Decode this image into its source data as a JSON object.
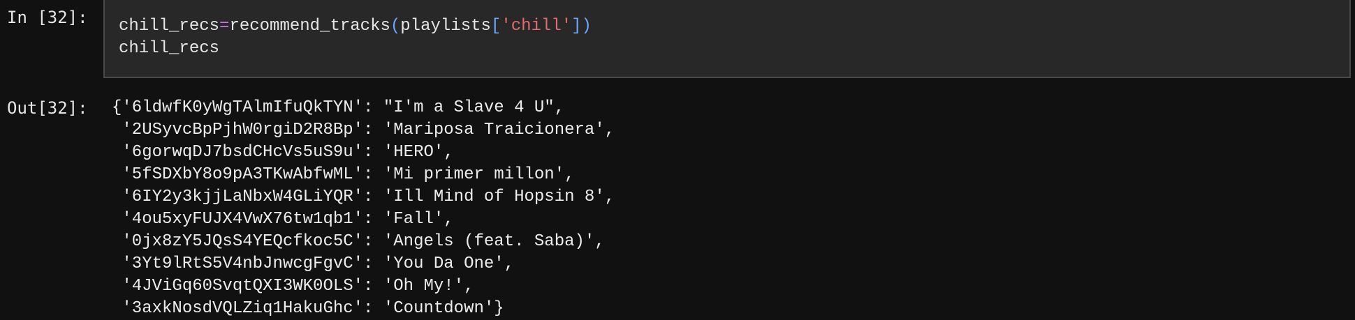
{
  "input_cell": {
    "prompt": "In [32]:",
    "code": {
      "line1": {
        "var": "chill_recs",
        "op": "=",
        "func": "recommend_tracks",
        "open_paren": "(",
        "arg_name": "playlists",
        "open_bracket": "[",
        "key": "'chill'",
        "close_bracket": "]",
        "close_paren": ")"
      },
      "line2": "chill_recs"
    }
  },
  "output_cell": {
    "prompt": "Out[32]:",
    "lines": [
      "{'6ldwfK0yWgTAlmIfuQkTYN': \"I'm a Slave 4 U\",",
      " '2USyvcBpPjhW0rgiD2R8Bp': 'Mariposa Traicionera',",
      " '6gorwqDJ7bsdCHcVs5uS9u': 'HERO',",
      " '5fSDXbY8o9pA3TKwAbfwML': 'Mi primer millon',",
      " '6IY2y3kjjLaNbxW4GLiYQR': 'Ill Mind of Hopsin 8',",
      " '4ou5xyFUJX4VwX76tw1qb1': 'Fall',",
      " '0jx8zY5JQsS4YEQcfkoc5C': 'Angels (feat. Saba)',",
      " '3Yt9lRtS5V4nbJnwcgFgvC': 'You Da One',",
      " '4JViGq60SvqtQXI3WK0OLS': 'Oh My!',",
      " '3axkNosdVQLZiq1HakuGhc': 'Countdown'}"
    ]
  },
  "colors": {
    "background": "#111111",
    "cell_background": "#282828",
    "operator": "#c678dd",
    "punctuation": "#6aa8ff",
    "string": "#e06c6c"
  }
}
